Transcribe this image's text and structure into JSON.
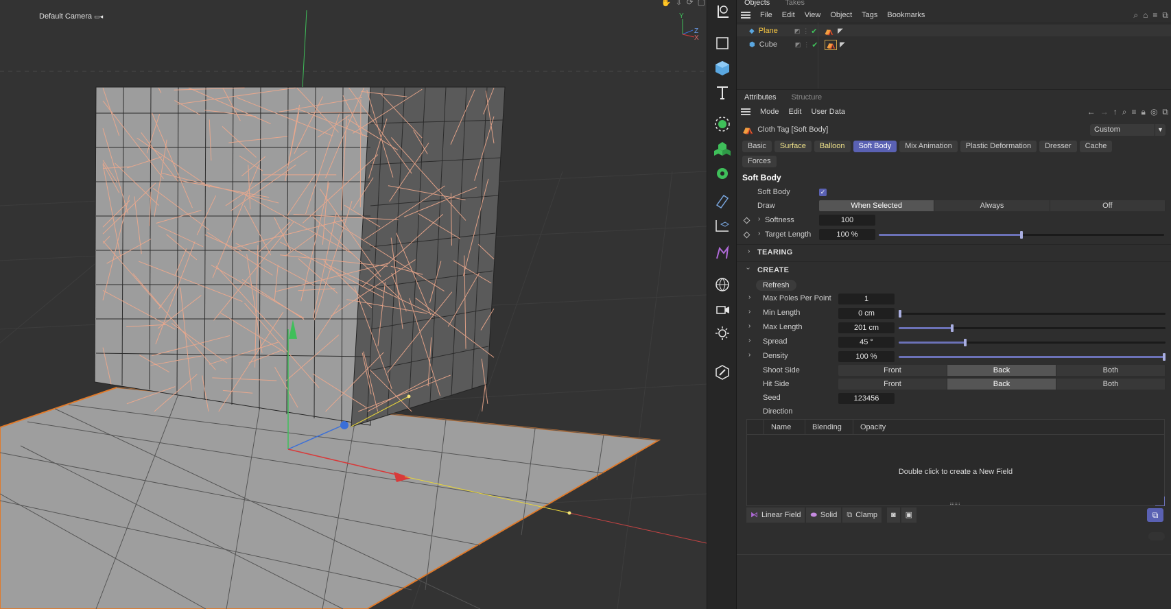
{
  "viewport": {
    "camera_label": "Default Camera",
    "axis_labels": {
      "y": "Y",
      "z": "Z",
      "x": "X"
    },
    "icons": [
      "hand-icon",
      "move-down-icon",
      "rotate-icon",
      "maximize-icon"
    ]
  },
  "toolbar": {
    "icons": [
      "select-lasso-icon",
      "rectangle-icon",
      "cube-icon",
      "text-icon",
      "generator-icon",
      "mograph-icon",
      "deformer-icon",
      "tag-icon",
      "spline-icon",
      "constraint-icon",
      "globe-icon",
      "camera-icon",
      "light-icon",
      "edit-icon"
    ]
  },
  "objects_panel": {
    "tabs": [
      "Objects",
      "Takes"
    ],
    "menu": [
      "File",
      "Edit",
      "View",
      "Object",
      "Tags",
      "Bookmarks"
    ],
    "items": [
      {
        "name": "Plane",
        "color": "#f5c542"
      },
      {
        "name": "Cube",
        "color": "#d6d6d6"
      }
    ]
  },
  "attributes_panel": {
    "tabs": [
      "Attributes",
      "Structure"
    ],
    "menu": [
      "Mode",
      "Edit",
      "User Data"
    ],
    "title": "Cloth Tag [Soft Body]",
    "preset": "Custom",
    "subtabs": [
      {
        "label": "Basic",
        "style": "normal"
      },
      {
        "label": "Surface",
        "style": "yellow"
      },
      {
        "label": "Balloon",
        "style": "yellow"
      },
      {
        "label": "Soft Body",
        "style": "active"
      },
      {
        "label": "Mix Animation",
        "style": "normal"
      },
      {
        "label": "Plastic Deformation",
        "style": "normal"
      },
      {
        "label": "Dresser",
        "style": "normal"
      },
      {
        "label": "Cache",
        "style": "normal"
      },
      {
        "label": "Forces",
        "style": "normal"
      }
    ],
    "section": "Soft Body",
    "soft_body_label": "Soft Body",
    "soft_body_checked": true,
    "draw_label": "Draw",
    "draw_options": [
      "When Selected",
      "Always",
      "Off"
    ],
    "draw_selected": "When Selected",
    "softness_label": "Softness",
    "softness_value": "100",
    "target_length_label": "Target Length",
    "target_length_value": "100 %",
    "target_length_fraction": 0.5,
    "tearing_label": "TEARING",
    "create_label": "CREATE",
    "refresh_label": "Refresh",
    "max_poles_label": "Max Poles Per Point",
    "max_poles_value": "1",
    "min_length_label": "Min Length",
    "min_length_value": "0 cm",
    "min_length_fraction": 0.0,
    "max_length_label": "Max Length",
    "max_length_value": "201 cm",
    "max_length_fraction": 0.2,
    "spread_label": "Spread",
    "spread_value": "45 °",
    "spread_fraction": 0.25,
    "density_label": "Density",
    "density_value": "100 %",
    "density_fraction": 1.0,
    "shoot_side_label": "Shoot Side",
    "shoot_side_options": [
      "Front",
      "Back",
      "Both"
    ],
    "shoot_side_selected": "Back",
    "hit_side_label": "Hit Side",
    "hit_side_options": [
      "Front",
      "Back",
      "Both"
    ],
    "hit_side_selected": "Back",
    "seed_label": "Seed",
    "seed_value": "123456",
    "direction_label": "Direction",
    "field_columns": [
      "Name",
      "Blending",
      "Opacity"
    ],
    "field_empty": "Double click to create a New Field",
    "field_buttons": [
      "Linear Field",
      "Solid",
      "Clamp"
    ]
  }
}
